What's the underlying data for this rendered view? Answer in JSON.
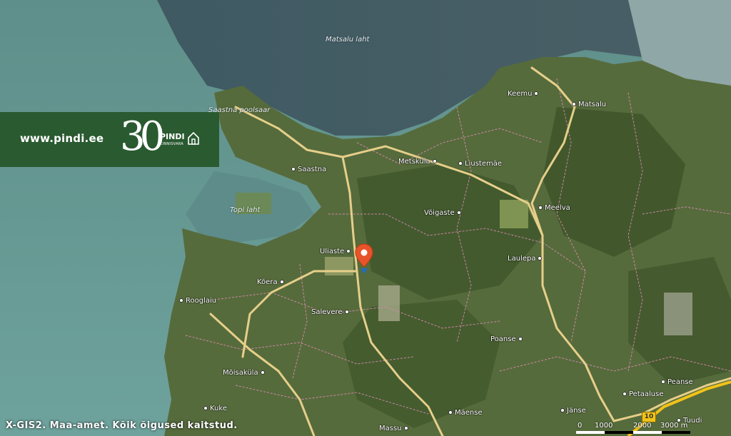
{
  "brand": {
    "url": "www.pindi.ee",
    "anniversary": "30",
    "name": "PINDI",
    "subname": "KINNISVARA",
    "color": "#2a5a30"
  },
  "water_labels": {
    "matsalu_laht": "Matsalu laht",
    "topi_laht": "Topi laht",
    "saastna_poolsaar": "Saastna poolsaar"
  },
  "places": {
    "keemu": "Keemu",
    "matsalu": "Matsalu",
    "saastna": "Saastna",
    "metskula": "Metsküla",
    "liustemae": "Liustemäe",
    "voigaste": "Võigaste",
    "meelva": "Meelva",
    "uliaste": "Uliaste",
    "laulepa": "Laulepa",
    "koera": "Kõera",
    "rooglaiu": "Rooglaiu",
    "salevere": "Salevere",
    "poanse": "Poanse",
    "moisakula": "Mõisaküla",
    "peanse": "Peanse",
    "petaaluse": "Petaaluse",
    "kuke": "Kuke",
    "maense": "Mäense",
    "janse": "Jänse",
    "massu": "Massu",
    "tuudi": "Tuudi"
  },
  "road_number": "10",
  "attribution": "X-GIS2. Maa-amet. Kõik õigused kaitstud.",
  "scale": {
    "ticks": [
      "0",
      "1000",
      "2000",
      "3000 m"
    ]
  },
  "marker": {
    "icon": "location-pin-icon",
    "color": "#e8542a"
  },
  "colors": {
    "water": "#3f6d6b",
    "land": "#5b6b3f",
    "road": "#e6cf8a",
    "parcel_border": "#d98ab0"
  }
}
